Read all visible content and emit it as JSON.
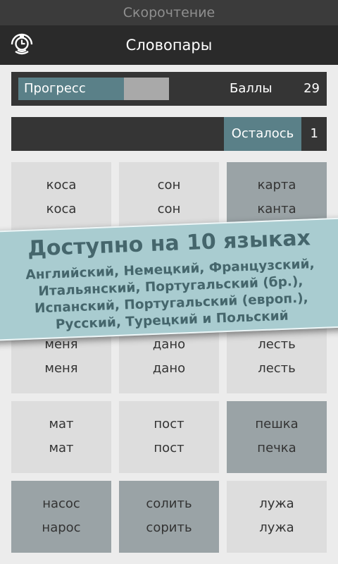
{
  "window": {
    "title": "Скорочтение"
  },
  "header": {
    "title": "Словопары",
    "icon": "stopwatch-icon"
  },
  "stats": {
    "progress_label": "Прогресс",
    "progress_fraction": 0.7,
    "score_label": "Баллы",
    "score_value": "29",
    "remaining_label": "Осталось",
    "remaining_value": "1"
  },
  "colors": {
    "accent": "#5a8088",
    "panel": "#353535",
    "card_same": "#dddddd",
    "card_diff": "#9aa3a6",
    "banner_bg": "#a9ccd0",
    "banner_text": "#45666c"
  },
  "cards": [
    {
      "w1": "коса",
      "w2": "коса",
      "different": false
    },
    {
      "w1": "сон",
      "w2": "сон",
      "different": false
    },
    {
      "w1": "карта",
      "w2": "канта",
      "different": true
    },
    {
      "w1": "",
      "w2": "",
      "different": false
    },
    {
      "w1": "",
      "w2": "",
      "different": false
    },
    {
      "w1": "",
      "w2": "",
      "different": false
    },
    {
      "w1": "меня",
      "w2": "меня",
      "different": false
    },
    {
      "w1": "дано",
      "w2": "дано",
      "different": false
    },
    {
      "w1": "лесть",
      "w2": "лесть",
      "different": false
    },
    {
      "w1": "мат",
      "w2": "мат",
      "different": false
    },
    {
      "w1": "пост",
      "w2": "пост",
      "different": false
    },
    {
      "w1": "пешка",
      "w2": "печка",
      "different": true
    },
    {
      "w1": "насос",
      "w2": "нарос",
      "different": true
    },
    {
      "w1": "солить",
      "w2": "сорить",
      "different": true
    },
    {
      "w1": "лужа",
      "w2": "лужа",
      "different": false
    }
  ],
  "banner": {
    "title": "Доступно на 10 языках",
    "lines": [
      "Английский, Немецкий, Французский,",
      "Итальянский, Португальский (бр.),",
      "Испанский, Португальский (европ.),",
      "Русский, Турецкий и Польский"
    ]
  }
}
